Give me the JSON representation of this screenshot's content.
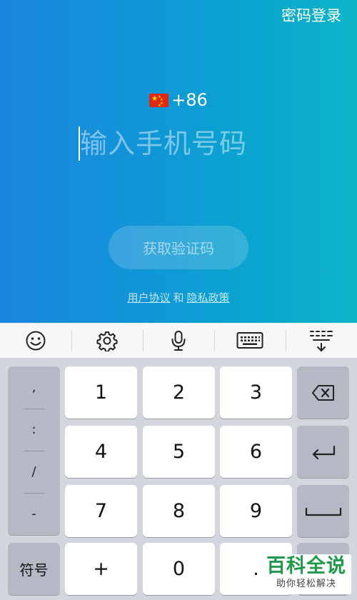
{
  "header": {
    "password_login": "密码登录"
  },
  "country": {
    "flag_icon": "china-flag-icon",
    "code": "+86"
  },
  "phone": {
    "placeholder": "输入手机号码",
    "value": ""
  },
  "actions": {
    "get_code": "获取验证码"
  },
  "agreement": {
    "terms": "用户协议",
    "and": "和",
    "privacy": "隐私政策"
  },
  "toolbar": {
    "items": [
      {
        "icon": "emoji-icon"
      },
      {
        "icon": "gear-icon"
      },
      {
        "icon": "microphone-icon"
      },
      {
        "icon": "keyboard-icon"
      },
      {
        "icon": "collapse-keyboard-icon"
      }
    ]
  },
  "keyboard": {
    "symbols": [
      ",",
      ":",
      "/",
      "-"
    ],
    "digits": [
      "1",
      "2",
      "3",
      "4",
      "5",
      "6",
      "7",
      "8",
      "9"
    ],
    "bottom": {
      "symbols_label": "符号",
      "plus": "+",
      "zero": "0",
      "dot": "."
    },
    "special_icons": [
      "backspace-icon",
      "enter-icon",
      "space-icon"
    ]
  },
  "watermark": {
    "title": "百科全说",
    "subtitle": "助你轻松解决"
  },
  "colors": {
    "gradient_start": "#1a86de",
    "gradient_end": "#0db5c8",
    "watermark_green": "#1f9a4a"
  }
}
